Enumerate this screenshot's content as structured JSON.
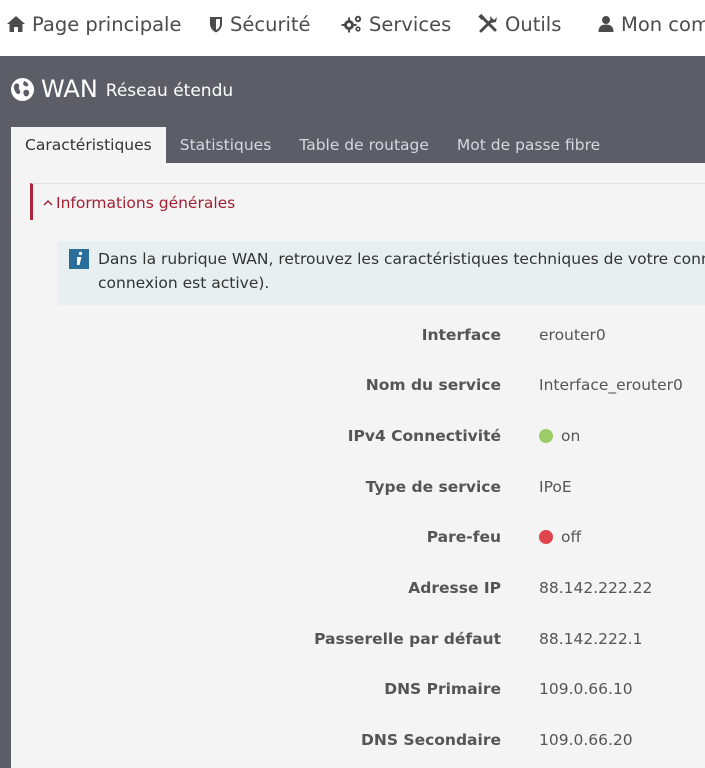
{
  "nav": {
    "home": "Page principale",
    "security": "Sécurité",
    "services": "Services",
    "tools": "Outils",
    "account": "Mon com"
  },
  "header": {
    "title": "WAN",
    "subtitle": "Réseau étendu"
  },
  "tabs": [
    {
      "label": "Caractéristiques",
      "active": true
    },
    {
      "label": "Statistiques",
      "active": false
    },
    {
      "label": "Table de routage",
      "active": false
    },
    {
      "label": "Mot de passe fibre",
      "active": false
    }
  ],
  "section": {
    "title": "Informations générales"
  },
  "info": {
    "line1": "Dans la rubrique WAN, retrouvez les caractéristiques techniques de votre connex",
    "line2": "connexion est active)."
  },
  "rows": [
    {
      "label": "Interface",
      "value": "erouter0"
    },
    {
      "label": "Nom du service",
      "value": "Interface_erouter0"
    },
    {
      "label": "IPv4 Connectivité",
      "value": "on",
      "status": "on"
    },
    {
      "label": "Type de service",
      "value": "IPoE"
    },
    {
      "label": "Pare-feu",
      "value": "off",
      "status": "off"
    },
    {
      "label": "Adresse IP",
      "value": "88.142.222.22"
    },
    {
      "label": "Passerelle par défaut",
      "value": "88.142.222.1"
    },
    {
      "label": "DNS Primaire",
      "value": "109.0.66.10"
    },
    {
      "label": "DNS Secondaire",
      "value": "109.0.66.20"
    }
  ],
  "colors": {
    "status_on": "#9ccc65",
    "status_off": "#e0454f",
    "accent": "#a31f33",
    "header_bg": "#5d5d67"
  }
}
